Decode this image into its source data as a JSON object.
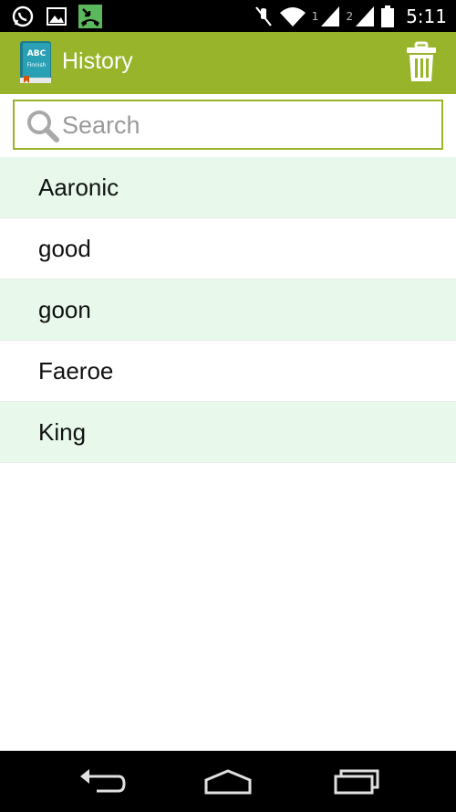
{
  "status_bar": {
    "time": "5:11",
    "sim1_label": "1",
    "sim2_label": "2",
    "icons": [
      "whatsapp-icon",
      "gallery-icon",
      "missed-call-icon",
      "mute-icon",
      "wifi-icon",
      "signal-icon",
      "battery-icon"
    ]
  },
  "app_bar": {
    "title": "History",
    "logo_text_top": "ABC",
    "logo_text_bottom": "Finnish",
    "delete_icon": "trash-icon"
  },
  "search": {
    "placeholder": "Search",
    "value": ""
  },
  "history": {
    "items": [
      {
        "label": "Aaronic"
      },
      {
        "label": "good"
      },
      {
        "label": "goon"
      },
      {
        "label": "Faeroe"
      },
      {
        "label": "King"
      }
    ]
  },
  "colors": {
    "accent": "#98b42a",
    "row_alt": "#e8f9ec",
    "status_bar": "#000000",
    "nav_bar": "#000000"
  },
  "nav_bar": {
    "icons": [
      "back-icon",
      "home-icon",
      "recents-icon"
    ]
  }
}
